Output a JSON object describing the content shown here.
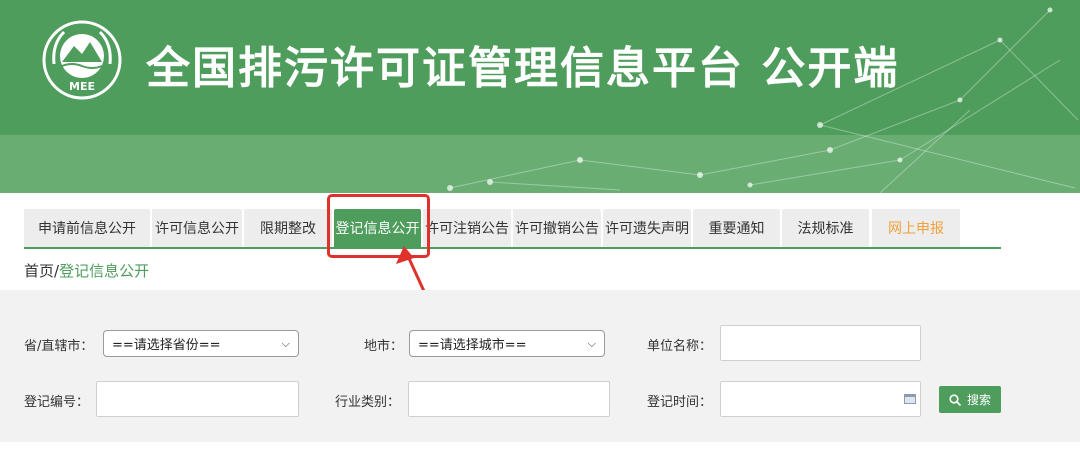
{
  "header": {
    "logo_text": "MEE",
    "title": "全国排污许可证管理信息平台  公开端"
  },
  "nav": {
    "tabs": [
      {
        "label": "申请前信息公开"
      },
      {
        "label": "许可信息公开"
      },
      {
        "label": "限期整改"
      },
      {
        "label": "登记信息公开",
        "active": true
      },
      {
        "label": "许可注销公告"
      },
      {
        "label": "许可撤销公告"
      },
      {
        "label": "许可遗失声明"
      },
      {
        "label": "重要通知"
      },
      {
        "label": "法规标准"
      },
      {
        "label": "网上申报",
        "color": "#f0a13a"
      }
    ]
  },
  "breadcrumb": {
    "home": "首页",
    "separator": "/",
    "current": "登记信息公开"
  },
  "search": {
    "province_label": "省/直辖市：",
    "province_value": "==请选择省份==",
    "city_label": "地市：",
    "city_value": "==请选择城市==",
    "unit_label": "单位名称：",
    "unit_value": "",
    "reg_no_label": "登记编号：",
    "reg_no_value": "",
    "industry_label": "行业类别：",
    "industry_value": "",
    "reg_time_label": "登记时间：",
    "reg_time_value": "",
    "button_label": "搜索"
  },
  "colors": {
    "primary_green": "#4f9d5c",
    "annotation_red": "#e0322c",
    "orange_tab": "#f0a13a"
  }
}
